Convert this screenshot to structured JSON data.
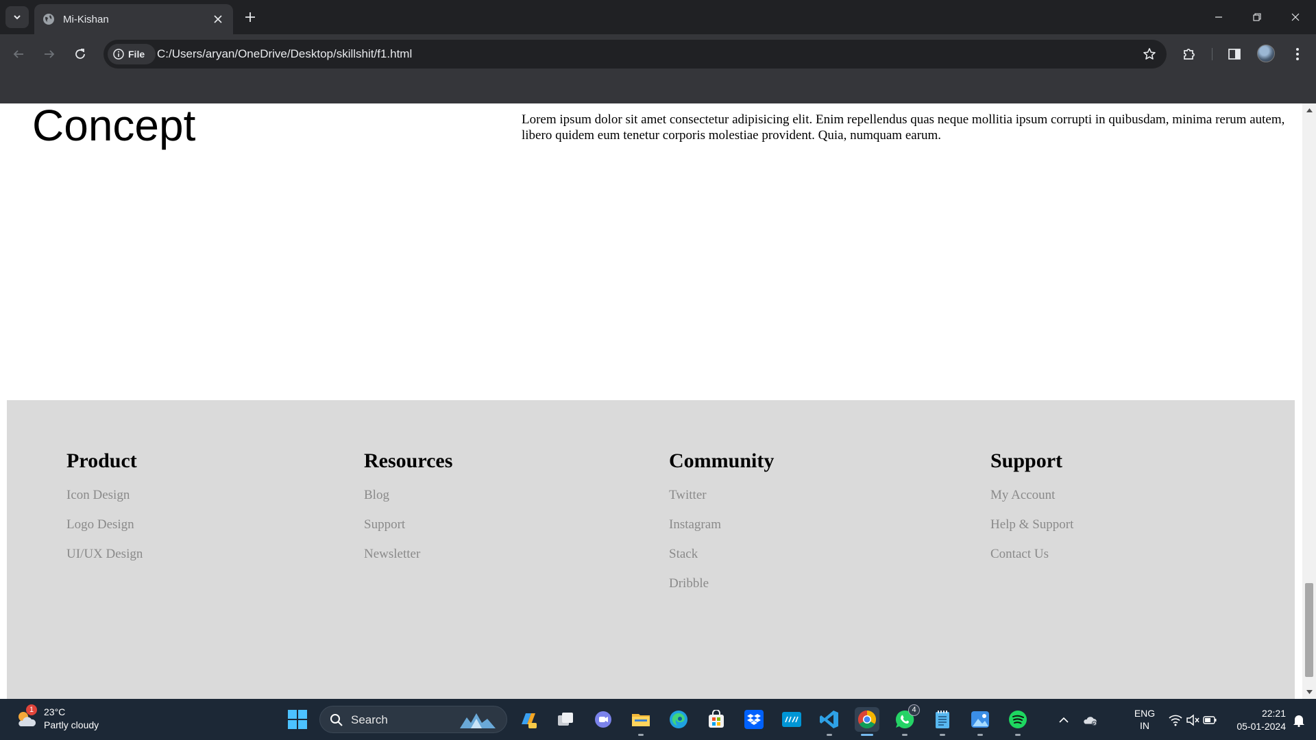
{
  "browser": {
    "tab_title": "Mi-Kishan",
    "site_chip_label": "File",
    "url": "C:/Users/aryan/OneDrive/Desktop/skillshit/f1.html"
  },
  "page": {
    "concept_title": "Concept",
    "concept_text": "Lorem ipsum dolor sit amet consectetur adipisicing elit. Enim repellendus quas neque mollitia ipsum corrupti in quibusdam, minima rerum autem, libero quidem eum tenetur corporis molestiae provident. Quia, numquam earum.",
    "footer": {
      "columns": [
        {
          "heading": "Product",
          "links": [
            "Icon Design",
            "Logo Design",
            "UI/UX Design"
          ]
        },
        {
          "heading": "Resources",
          "links": [
            "Blog",
            "Support",
            "Newsletter"
          ]
        },
        {
          "heading": "Community",
          "links": [
            "Twitter",
            "Instagram",
            "Stack",
            "Dribble"
          ]
        },
        {
          "heading": "Support",
          "links": [
            "My Account",
            "Help & Support",
            "Contact Us"
          ]
        }
      ]
    }
  },
  "taskbar": {
    "weather": {
      "badge": "1",
      "temp": "23°C",
      "condition": "Partly cloudy"
    },
    "search_label": "Search",
    "whatsapp_badge": "4",
    "language": {
      "line1": "ENG",
      "line2": "IN"
    },
    "clock": {
      "time": "22:21",
      "date": "05-01-2024"
    }
  },
  "colors": {
    "chrome_dark": "#202124",
    "chrome_toolbar": "#35363a",
    "footer_bg": "#dadada",
    "footer_link": "#8a8a8a",
    "taskbar_bg": "#1c2836"
  }
}
